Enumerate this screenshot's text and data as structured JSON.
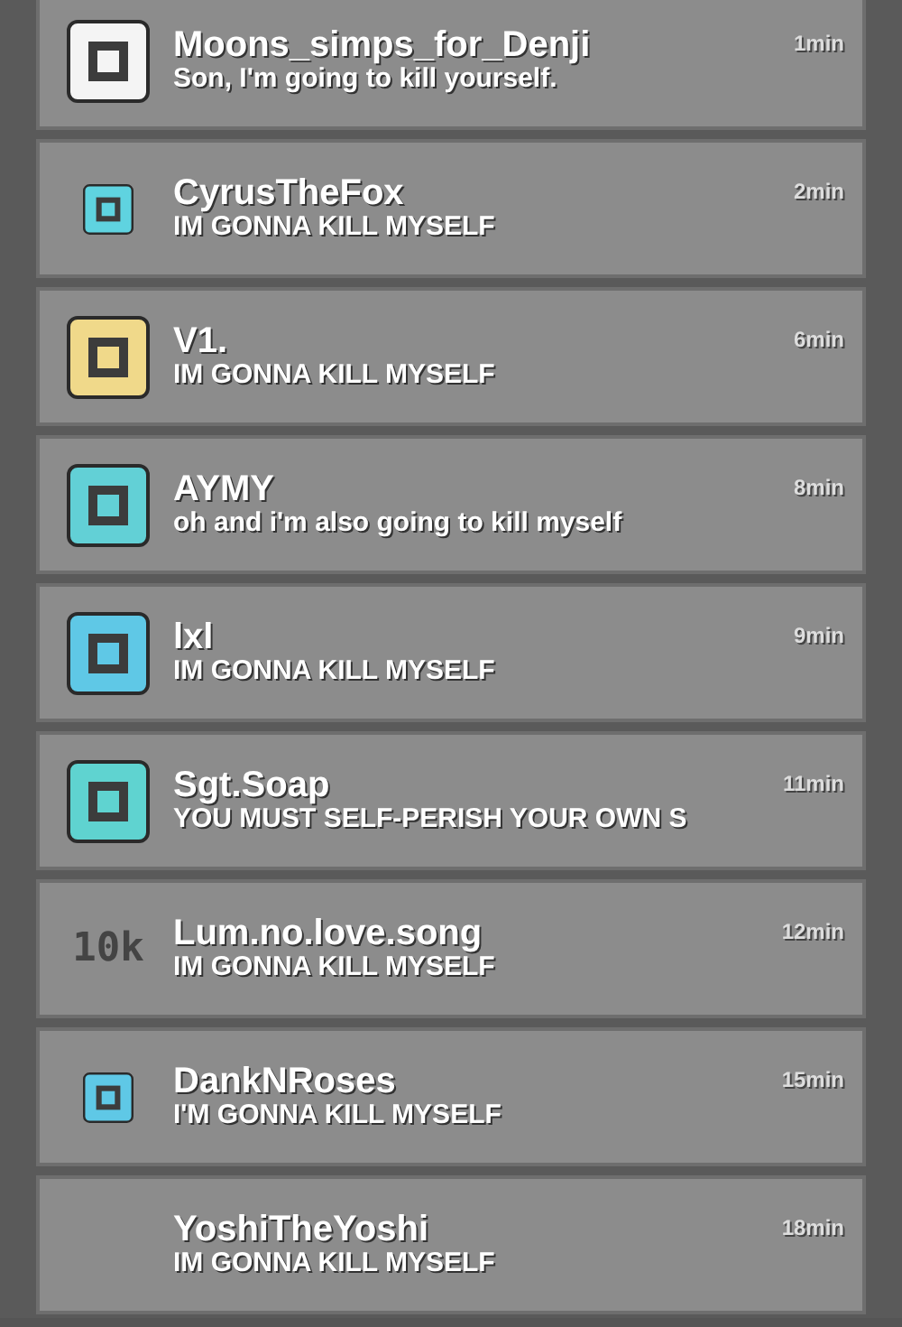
{
  "comments": [
    {
      "user": "Moons_simps_for_Denji",
      "text": "Son, I'm going to kill yourself.",
      "time": "1min",
      "icon": {
        "kind": "block",
        "color": "#f4f4f4"
      }
    },
    {
      "user": "CyrusTheFox",
      "text": "IM GONNA KILL MYSELF",
      "time": "2min",
      "icon": {
        "kind": "mini",
        "color": "#5fd3e0"
      }
    },
    {
      "user": "V1.",
      "text": "IM GONNA KILL MYSELF",
      "time": "6min",
      "icon": {
        "kind": "block",
        "color": "#f0d98a"
      }
    },
    {
      "user": "AYMY",
      "text": "oh and i'm also going to kill myself",
      "time": "8min",
      "icon": {
        "kind": "block",
        "color": "#62d0d6"
      }
    },
    {
      "user": "lxl",
      "text": "IM GONNA KILL MYSELF",
      "time": "9min",
      "icon": {
        "kind": "block",
        "color": "#5fc8e6"
      }
    },
    {
      "user": "Sgt.Soap",
      "text": "YOU MUST SELF-PERISH YOUR OWN S",
      "time": "11min",
      "icon": {
        "kind": "block",
        "color": "#5fd3d0"
      }
    },
    {
      "user": "Lum.no.love.song",
      "text": "IM GONNA KILL MYSELF",
      "time": "12min",
      "icon": {
        "kind": "text",
        "label": "10k"
      }
    },
    {
      "user": "DankNRoses",
      "text": "I'M GONNA KILL MYSELF",
      "time": "15min",
      "icon": {
        "kind": "mini",
        "color": "#5fc8e6"
      }
    },
    {
      "user": "YoshiTheYoshi",
      "text": "IM GONNA KILL MYSELF",
      "time": "18min"
    }
  ]
}
